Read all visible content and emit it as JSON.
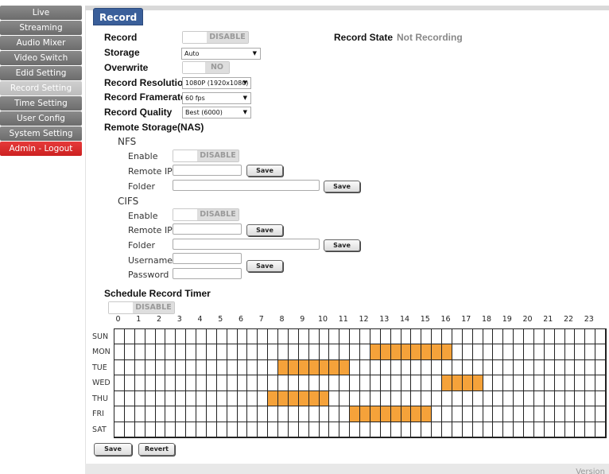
{
  "sidebar": {
    "items": [
      {
        "label": "Live"
      },
      {
        "label": "Streaming"
      },
      {
        "label": "Audio Mixer"
      },
      {
        "label": "Video Switch"
      },
      {
        "label": "Edid Setting"
      },
      {
        "label": "Record Setting"
      },
      {
        "label": "Time Setting"
      },
      {
        "label": "User Config"
      },
      {
        "label": "System Setting"
      },
      {
        "label": "Admin - Logout"
      }
    ],
    "active_index": 5
  },
  "tab": {
    "label": "Record"
  },
  "record": {
    "record_label": "Record",
    "record_toggle": "DISABLE",
    "record_state_label": "Record State",
    "record_state_value": "Not Recording",
    "storage_label": "Storage",
    "storage_value": "Auto",
    "overwrite_label": "Overwrite",
    "overwrite_toggle": "NO",
    "resolution_label": "Record Resolution",
    "resolution_value": "1080P (1920x1080)",
    "framerate_label": "Record Framerate",
    "framerate_value": "60 fps",
    "quality_label": "Record Quality",
    "quality_value": "Best (6000)"
  },
  "nas": {
    "title": "Remote Storage(NAS)",
    "nfs": {
      "title": "NFS",
      "enable_label": "Enable",
      "enable_toggle": "DISABLE",
      "remote_ip_label": "Remote IP",
      "remote_ip_value": "",
      "save_label": "Save",
      "folder_label": "Folder",
      "folder_value": "",
      "folder_save_label": "Save"
    },
    "cifs": {
      "title": "CIFS",
      "enable_label": "Enable",
      "enable_toggle": "DISABLE",
      "remote_ip_label": "Remote IP",
      "remote_ip_value": "",
      "save_label": "Save",
      "folder_label": "Folder",
      "folder_value": "",
      "folder_save_label": "Save",
      "username_label": "Username",
      "password_label": "Password",
      "credentials_save_label": "Save"
    }
  },
  "schedule": {
    "title": "Schedule Record Timer",
    "toggle": "DISABLE",
    "hours": [
      "0",
      "1",
      "2",
      "3",
      "4",
      "5",
      "6",
      "7",
      "8",
      "9",
      "10",
      "11",
      "12",
      "13",
      "14",
      "15",
      "16",
      "17",
      "18",
      "19",
      "20",
      "21",
      "22",
      "23"
    ],
    "days": [
      "SUN",
      "MON",
      "TUE",
      "WED",
      "THU",
      "FRI",
      "SAT"
    ],
    "cols": 48,
    "selected": {
      "SUN": [],
      "MON": [
        [
          25,
          33
        ]
      ],
      "TUE": [
        [
          16,
          23
        ]
      ],
      "WED": [
        [
          32,
          36
        ]
      ],
      "THU": [
        [
          15,
          21
        ]
      ],
      "FRI": [
        [
          23,
          31
        ]
      ],
      "SAT": []
    },
    "active_color": "#f5a23a"
  },
  "footer": {
    "save_label": "Save",
    "revert_label": "Revert",
    "version_label": "Version"
  }
}
